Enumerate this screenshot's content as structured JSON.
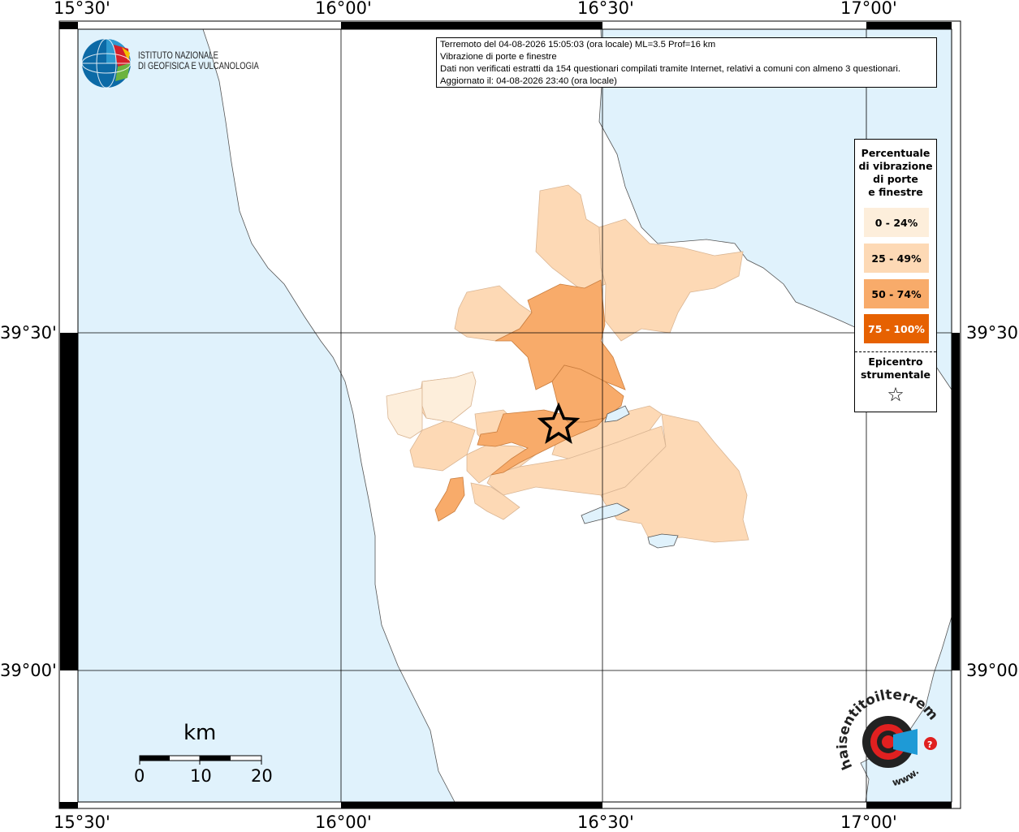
{
  "frame": {
    "top_labels": [
      "15°30'",
      "16°00'",
      "16°30'",
      "17°00'"
    ],
    "bottom_labels": [
      "15°30'",
      "16°00'",
      "16°30'",
      "17°00'"
    ],
    "left_labels": [
      "39°30'",
      "39°00'"
    ],
    "right_labels": [
      "39°30'",
      "39°00'"
    ]
  },
  "logo": {
    "line1": "ISTITUTO NAZIONALE",
    "line2": "DI GEOFISICA E VULCANOLOGIA"
  },
  "info": {
    "line1": "Terremoto del 04-08-2026 15:05:03 (ora locale) ML=3.5 Prof=16 km",
    "line2": "Vibrazione di porte e finestre",
    "line3": "Dati non verificati estratti da 154 questionari compilati tramite Internet, relativi a comuni con almeno 3 questionari.",
    "line4": "Aggiornato il: 04-08-2026 23:40 (ora locale)"
  },
  "legend": {
    "title_lines": [
      "Percentuale",
      "di vibrazione",
      "di porte",
      "e finestre"
    ],
    "classes": [
      {
        "label": "0 - 24%",
        "color": "#fdeedb",
        "text_color": "#000000"
      },
      {
        "label": "25 - 49%",
        "color": "#fdd9b5",
        "text_color": "#000000"
      },
      {
        "label": "50 - 74%",
        "color": "#f8ab6a",
        "text_color": "#000000"
      },
      {
        "label": "75 - 100%",
        "color": "#e66101",
        "text_color": "#ffffff"
      }
    ],
    "epicenter_lines": [
      "Epicentro",
      "strumentale"
    ],
    "epicenter_symbol": "☆"
  },
  "scale": {
    "unit": "km",
    "ticks": [
      "0",
      "10",
      "20"
    ]
  },
  "watermark": {
    "text": "haisentitoilterremoto.it",
    "url_part": "www."
  },
  "colors": {
    "sea": "#e0f2fc",
    "land": "#ffffff",
    "grid": "#000000"
  }
}
